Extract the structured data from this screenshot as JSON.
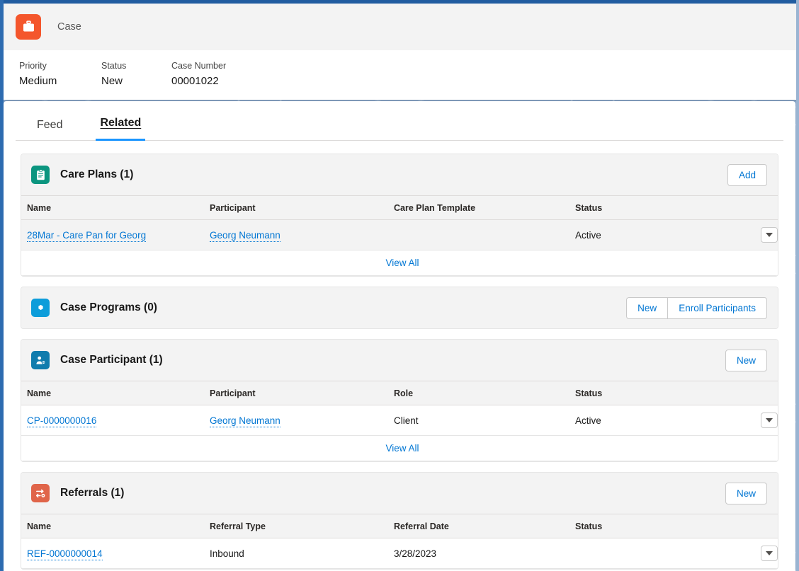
{
  "record_header": {
    "object_icon": "briefcase-icon",
    "object_icon_color": "#f4562c",
    "object_label": "Case",
    "fields": [
      {
        "label": "Priority",
        "value": "Medium"
      },
      {
        "label": "Status",
        "value": "New"
      },
      {
        "label": "Case Number",
        "value": "00001022"
      }
    ]
  },
  "tabs": [
    {
      "label": "Feed",
      "active": false
    },
    {
      "label": "Related",
      "active": true
    }
  ],
  "accent_color": "#1b96ff",
  "link_color": "#0176d3",
  "cards": [
    {
      "icon": "clipboard-icon",
      "icon_color": "#0b957f",
      "title": "Care Plans (1)",
      "actions": [
        {
          "label": "Add"
        }
      ],
      "columns": [
        "Name",
        "Participant",
        "Care Plan Template",
        "Status"
      ],
      "rows": [
        {
          "hovered": true,
          "cells": [
            {
              "text": "28Mar - Care Pan for Georg",
              "link": true
            },
            {
              "text": "Georg Neumann",
              "link": true
            },
            {
              "text": ""
            },
            {
              "text": "Active"
            }
          ],
          "row_menu": "chevron-down-icon"
        }
      ],
      "view_all": "View All"
    },
    {
      "icon": "program-icon",
      "icon_color": "#0d9dda",
      "title": "Case Programs (0)",
      "actions": [
        {
          "label": "New"
        },
        {
          "label": "Enroll Participants"
        }
      ],
      "grouped_actions": true,
      "columns": [],
      "rows": [],
      "view_all": null
    },
    {
      "icon": "case-participant-icon",
      "icon_color": "#107cad",
      "title": "Case Participant (1)",
      "actions": [
        {
          "label": "New"
        }
      ],
      "columns": [
        "Name",
        "Participant",
        "Role",
        "Status"
      ],
      "rows": [
        {
          "hovered": false,
          "cells": [
            {
              "text": "CP-0000000016",
              "link": true
            },
            {
              "text": "Georg Neumann",
              "link": true
            },
            {
              "text": "Client"
            },
            {
              "text": "Active"
            }
          ],
          "row_menu": "chevron-down-icon"
        }
      ],
      "view_all": "View All"
    },
    {
      "icon": "referrals-icon",
      "icon_color": "#e0654a",
      "title": "Referrals (1)",
      "actions": [
        {
          "label": "New"
        }
      ],
      "columns": [
        "Name",
        "Referral Type",
        "Referral Date",
        "Status"
      ],
      "rows": [
        {
          "hovered": false,
          "cells": [
            {
              "text": "REF-0000000014",
              "link": true
            },
            {
              "text": "Inbound"
            },
            {
              "text": "3/28/2023"
            },
            {
              "text": ""
            }
          ],
          "row_menu": "chevron-down-icon"
        }
      ],
      "view_all": null
    }
  ]
}
